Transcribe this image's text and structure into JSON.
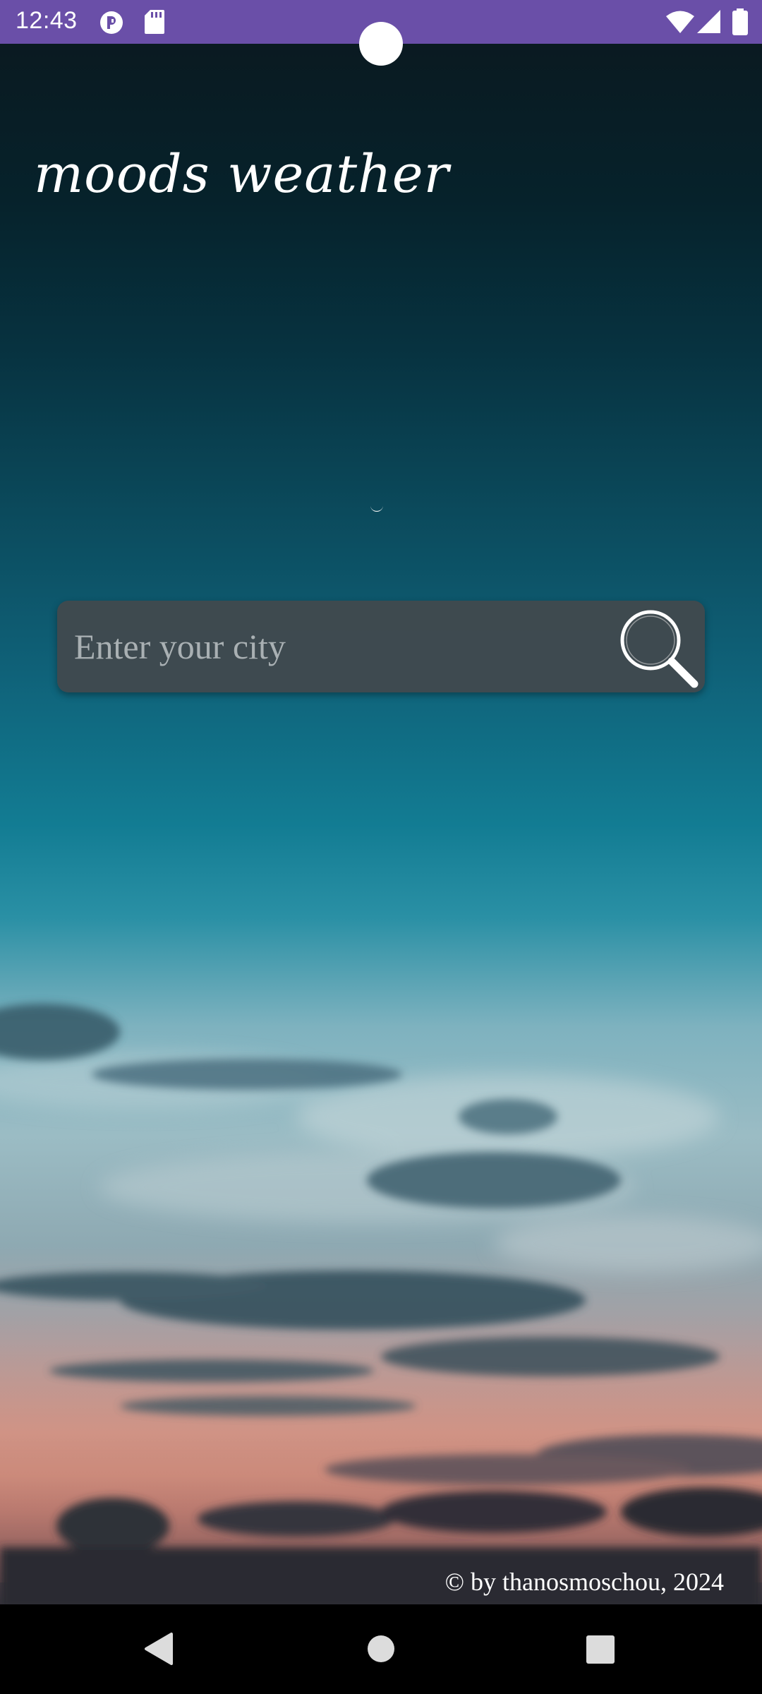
{
  "status_bar": {
    "time": "12:43",
    "left_icons": [
      "privacy-indicator-icon",
      "sd-card-icon"
    ],
    "right_icons": [
      "wifi-icon",
      "cellular-signal-icon",
      "battery-icon"
    ],
    "background_color": "#6a4fa8"
  },
  "app": {
    "title": "moods weather",
    "search": {
      "placeholder": "Enter your city",
      "value": "",
      "button_icon": "search-icon"
    },
    "copyright": "© by thanosmoschou, 2024"
  },
  "nav_bar": {
    "buttons": [
      "back-icon",
      "home-icon",
      "recents-icon"
    ]
  },
  "colors": {
    "text": "#ffffff",
    "search_background": "#40494e",
    "placeholder": "#a9b0b3"
  }
}
